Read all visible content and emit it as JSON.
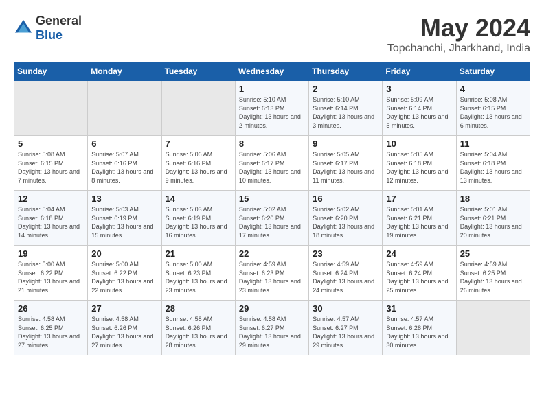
{
  "logo": {
    "general": "General",
    "blue": "Blue"
  },
  "title": "May 2024",
  "subtitle": "Topchanchi, Jharkhand, India",
  "days_header": [
    "Sunday",
    "Monday",
    "Tuesday",
    "Wednesday",
    "Thursday",
    "Friday",
    "Saturday"
  ],
  "weeks": [
    [
      {
        "day": "",
        "sunrise": "",
        "sunset": "",
        "daylight": ""
      },
      {
        "day": "",
        "sunrise": "",
        "sunset": "",
        "daylight": ""
      },
      {
        "day": "",
        "sunrise": "",
        "sunset": "",
        "daylight": ""
      },
      {
        "day": "1",
        "sunrise": "Sunrise: 5:10 AM",
        "sunset": "Sunset: 6:13 PM",
        "daylight": "Daylight: 13 hours and 2 minutes."
      },
      {
        "day": "2",
        "sunrise": "Sunrise: 5:10 AM",
        "sunset": "Sunset: 6:14 PM",
        "daylight": "Daylight: 13 hours and 3 minutes."
      },
      {
        "day": "3",
        "sunrise": "Sunrise: 5:09 AM",
        "sunset": "Sunset: 6:14 PM",
        "daylight": "Daylight: 13 hours and 5 minutes."
      },
      {
        "day": "4",
        "sunrise": "Sunrise: 5:08 AM",
        "sunset": "Sunset: 6:15 PM",
        "daylight": "Daylight: 13 hours and 6 minutes."
      }
    ],
    [
      {
        "day": "5",
        "sunrise": "Sunrise: 5:08 AM",
        "sunset": "Sunset: 6:15 PM",
        "daylight": "Daylight: 13 hours and 7 minutes."
      },
      {
        "day": "6",
        "sunrise": "Sunrise: 5:07 AM",
        "sunset": "Sunset: 6:16 PM",
        "daylight": "Daylight: 13 hours and 8 minutes."
      },
      {
        "day": "7",
        "sunrise": "Sunrise: 5:06 AM",
        "sunset": "Sunset: 6:16 PM",
        "daylight": "Daylight: 13 hours and 9 minutes."
      },
      {
        "day": "8",
        "sunrise": "Sunrise: 5:06 AM",
        "sunset": "Sunset: 6:17 PM",
        "daylight": "Daylight: 13 hours and 10 minutes."
      },
      {
        "day": "9",
        "sunrise": "Sunrise: 5:05 AM",
        "sunset": "Sunset: 6:17 PM",
        "daylight": "Daylight: 13 hours and 11 minutes."
      },
      {
        "day": "10",
        "sunrise": "Sunrise: 5:05 AM",
        "sunset": "Sunset: 6:18 PM",
        "daylight": "Daylight: 13 hours and 12 minutes."
      },
      {
        "day": "11",
        "sunrise": "Sunrise: 5:04 AM",
        "sunset": "Sunset: 6:18 PM",
        "daylight": "Daylight: 13 hours and 13 minutes."
      }
    ],
    [
      {
        "day": "12",
        "sunrise": "Sunrise: 5:04 AM",
        "sunset": "Sunset: 6:18 PM",
        "daylight": "Daylight: 13 hours and 14 minutes."
      },
      {
        "day": "13",
        "sunrise": "Sunrise: 5:03 AM",
        "sunset": "Sunset: 6:19 PM",
        "daylight": "Daylight: 13 hours and 15 minutes."
      },
      {
        "day": "14",
        "sunrise": "Sunrise: 5:03 AM",
        "sunset": "Sunset: 6:19 PM",
        "daylight": "Daylight: 13 hours and 16 minutes."
      },
      {
        "day": "15",
        "sunrise": "Sunrise: 5:02 AM",
        "sunset": "Sunset: 6:20 PM",
        "daylight": "Daylight: 13 hours and 17 minutes."
      },
      {
        "day": "16",
        "sunrise": "Sunrise: 5:02 AM",
        "sunset": "Sunset: 6:20 PM",
        "daylight": "Daylight: 13 hours and 18 minutes."
      },
      {
        "day": "17",
        "sunrise": "Sunrise: 5:01 AM",
        "sunset": "Sunset: 6:21 PM",
        "daylight": "Daylight: 13 hours and 19 minutes."
      },
      {
        "day": "18",
        "sunrise": "Sunrise: 5:01 AM",
        "sunset": "Sunset: 6:21 PM",
        "daylight": "Daylight: 13 hours and 20 minutes."
      }
    ],
    [
      {
        "day": "19",
        "sunrise": "Sunrise: 5:00 AM",
        "sunset": "Sunset: 6:22 PM",
        "daylight": "Daylight: 13 hours and 21 minutes."
      },
      {
        "day": "20",
        "sunrise": "Sunrise: 5:00 AM",
        "sunset": "Sunset: 6:22 PM",
        "daylight": "Daylight: 13 hours and 22 minutes."
      },
      {
        "day": "21",
        "sunrise": "Sunrise: 5:00 AM",
        "sunset": "Sunset: 6:23 PM",
        "daylight": "Daylight: 13 hours and 23 minutes."
      },
      {
        "day": "22",
        "sunrise": "Sunrise: 4:59 AM",
        "sunset": "Sunset: 6:23 PM",
        "daylight": "Daylight: 13 hours and 23 minutes."
      },
      {
        "day": "23",
        "sunrise": "Sunrise: 4:59 AM",
        "sunset": "Sunset: 6:24 PM",
        "daylight": "Daylight: 13 hours and 24 minutes."
      },
      {
        "day": "24",
        "sunrise": "Sunrise: 4:59 AM",
        "sunset": "Sunset: 6:24 PM",
        "daylight": "Daylight: 13 hours and 25 minutes."
      },
      {
        "day": "25",
        "sunrise": "Sunrise: 4:59 AM",
        "sunset": "Sunset: 6:25 PM",
        "daylight": "Daylight: 13 hours and 26 minutes."
      }
    ],
    [
      {
        "day": "26",
        "sunrise": "Sunrise: 4:58 AM",
        "sunset": "Sunset: 6:25 PM",
        "daylight": "Daylight: 13 hours and 27 minutes."
      },
      {
        "day": "27",
        "sunrise": "Sunrise: 4:58 AM",
        "sunset": "Sunset: 6:26 PM",
        "daylight": "Daylight: 13 hours and 27 minutes."
      },
      {
        "day": "28",
        "sunrise": "Sunrise: 4:58 AM",
        "sunset": "Sunset: 6:26 PM",
        "daylight": "Daylight: 13 hours and 28 minutes."
      },
      {
        "day": "29",
        "sunrise": "Sunrise: 4:58 AM",
        "sunset": "Sunset: 6:27 PM",
        "daylight": "Daylight: 13 hours and 29 minutes."
      },
      {
        "day": "30",
        "sunrise": "Sunrise: 4:57 AM",
        "sunset": "Sunset: 6:27 PM",
        "daylight": "Daylight: 13 hours and 29 minutes."
      },
      {
        "day": "31",
        "sunrise": "Sunrise: 4:57 AM",
        "sunset": "Sunset: 6:28 PM",
        "daylight": "Daylight: 13 hours and 30 minutes."
      },
      {
        "day": "",
        "sunrise": "",
        "sunset": "",
        "daylight": ""
      }
    ]
  ]
}
